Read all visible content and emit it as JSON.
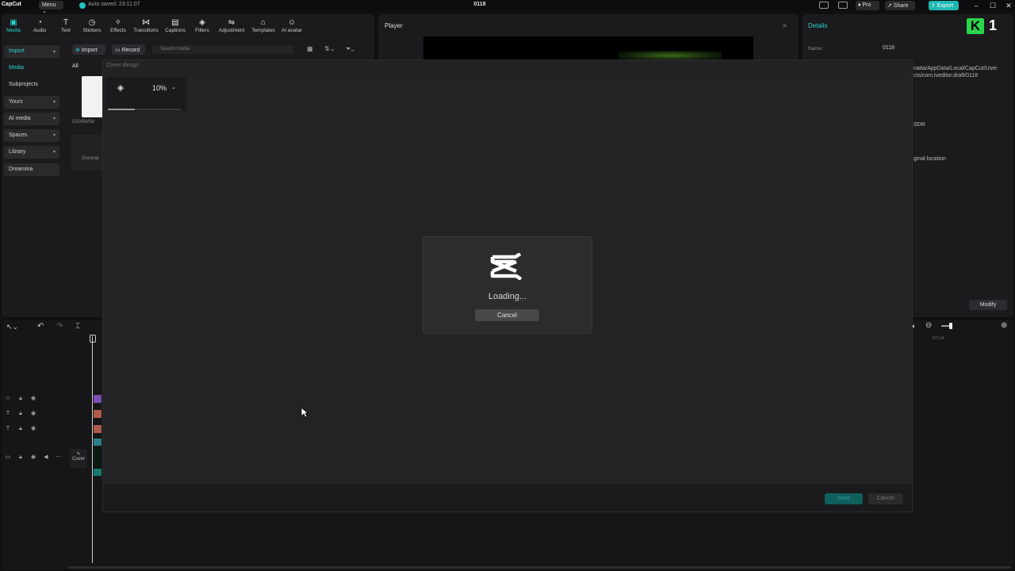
{
  "titlebar": {
    "logo": "CapCut",
    "menu": "Menu ⌄",
    "autosave": "Auto saved: 23:11:07",
    "project_title": "0118",
    "pro": "♦ Pro",
    "share": "↗ Share",
    "export": "⇪ Export"
  },
  "media_tools": [
    {
      "label": "Media",
      "icon": "▣"
    },
    {
      "label": "Audio",
      "icon": "◔"
    },
    {
      "label": "Text",
      "icon": "T"
    },
    {
      "label": "Stickers",
      "icon": "◷"
    },
    {
      "label": "Effects",
      "icon": "✧"
    },
    {
      "label": "Transitions",
      "icon": "⋈"
    },
    {
      "label": "Captions",
      "icon": "▤"
    },
    {
      "label": "Filters",
      "icon": "◈"
    },
    {
      "label": "Adjustment",
      "icon": "⇋"
    },
    {
      "label": "Templates",
      "icon": "⌂"
    },
    {
      "label": "AI avatar",
      "icon": "☺"
    }
  ],
  "sidebar": {
    "items": [
      {
        "label": "Import"
      },
      {
        "label": "Media"
      },
      {
        "label": "Subprojects"
      },
      {
        "label": "Yours"
      },
      {
        "label": "AI media"
      },
      {
        "label": "Spaces"
      },
      {
        "label": "Library"
      },
      {
        "label": "Dreamina"
      }
    ]
  },
  "media": {
    "import_label": "Import",
    "record_label": "Record",
    "search_placeholder": "Search media",
    "filter_all": "All",
    "thumb_name": "53049ef5d",
    "generate_label": "Generat"
  },
  "player": {
    "title": "Player"
  },
  "details": {
    "title": "Details",
    "name_label": "Name:",
    "name_value": "0118",
    "path_fragment_1": "natia/AppData/Local/CapCut/User",
    "path_fragment_2": "cts/com.lveditor.draft/0118",
    "hdr_fragment": "SDR",
    "location_fragment": "ginal location",
    "modify_label": "Modify",
    "badge_letter": "K",
    "badge_number": "1"
  },
  "timeline": {
    "cover_label": "Cover",
    "time_marker": "00:14"
  },
  "cover_modal": {
    "title": "Cover design",
    "zoom_value": "10%",
    "save_label": "Save",
    "cancel_label": "Cancel"
  },
  "loading": {
    "text": "Loading...",
    "cancel_label": "Cancel"
  },
  "colors": {
    "accent": "#2ad3cf",
    "export_bg": "#1fb7b3",
    "background": "#101012",
    "modal_bg": "#222224"
  }
}
